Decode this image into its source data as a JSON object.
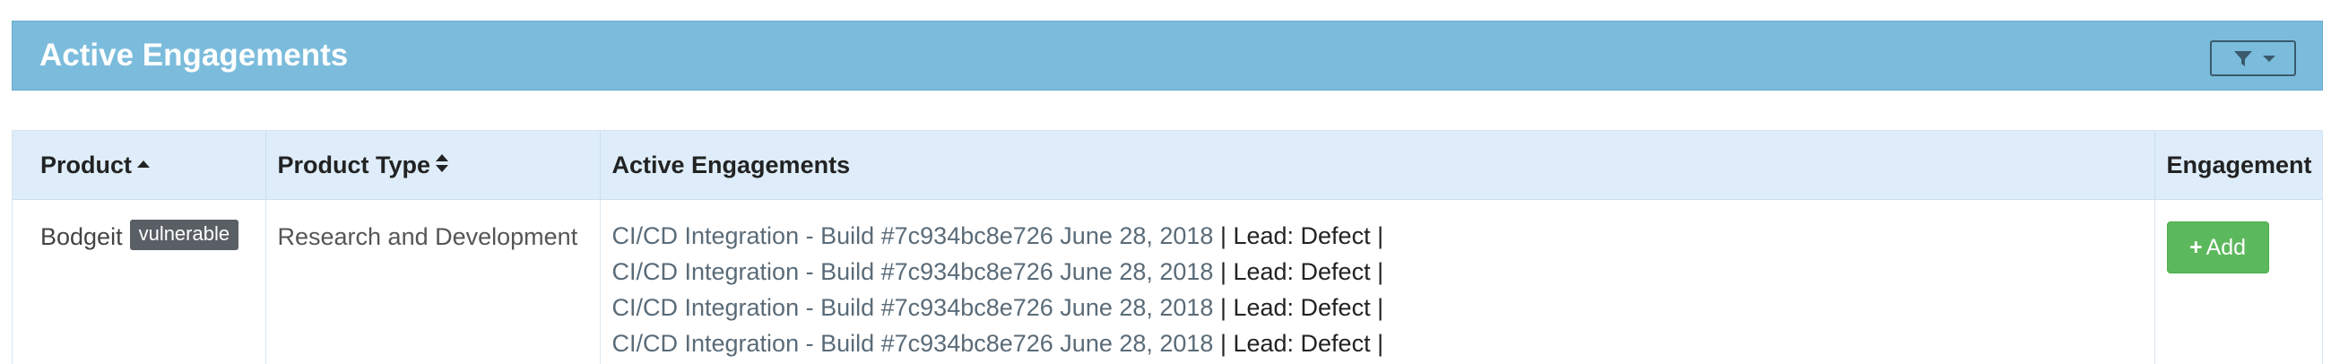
{
  "panel": {
    "title": "Active Engagements"
  },
  "table": {
    "headers": {
      "product": "Product",
      "product_type": "Product Type",
      "active_engagements": "Active Engagements",
      "engagement": "Engagement"
    },
    "rows": [
      {
        "product": "Bodgeit",
        "badge": "vulnerable",
        "product_type": "Research and Development",
        "engagements": [
          {
            "name": "CI/CD Integration - Build #7c934bc8e726 June 28, 2018",
            "lead": " | Lead: Defect |"
          },
          {
            "name": "CI/CD Integration - Build #7c934bc8e726 June 28, 2018",
            "lead": " | Lead: Defect |"
          },
          {
            "name": "CI/CD Integration - Build #7c934bc8e726 June 28, 2018",
            "lead": " | Lead: Defect |"
          },
          {
            "name": "CI/CD Integration - Build #7c934bc8e726 June 28, 2018",
            "lead": " | Lead: Defect |"
          }
        ],
        "add_label": "Add"
      }
    ]
  },
  "icons": {
    "filter": "filter-icon",
    "caret": "caret-down-icon",
    "sort_asc": "sort-asc-icon",
    "sort_both": "sort-icon",
    "plus": "plus-icon"
  },
  "colors": {
    "panel_header": "#7bbcdc",
    "table_header": "#deedf9",
    "badge": "#5a5f66",
    "add_button": "#5cb85c"
  }
}
